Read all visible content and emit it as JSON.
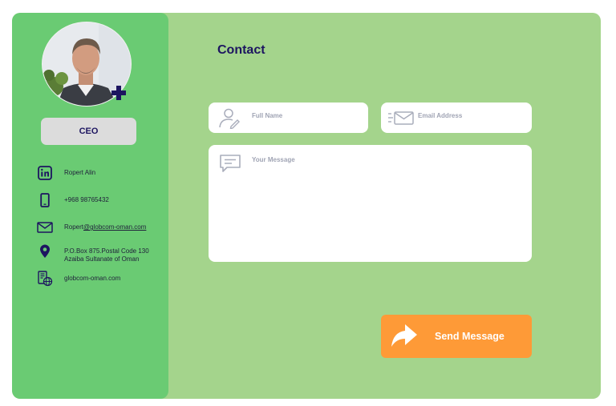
{
  "profile": {
    "role": "CEO"
  },
  "contact_info": {
    "name": "Ropert Alin",
    "phone": "+968 98765432",
    "email_prefix": "Ropert",
    "email_domain": "@globcom-oman.com",
    "address_line1": "P.O.Box 875.Postal Code 130",
    "address_line2": "Azaiba Sultanate of Oman",
    "website": "globcom-oman.com"
  },
  "form": {
    "title": "Contact",
    "full_name_placeholder": "Full Name",
    "email_placeholder": "Email Address",
    "message_placeholder": "Your Message",
    "send_label": "Send Message"
  },
  "colors": {
    "page_bg": "#a4d48c",
    "sidebar_bg": "#6acb73",
    "accent_dark": "#1d1560",
    "button": "#fe9a37"
  },
  "icons": [
    "plus-icon",
    "linkedin-icon",
    "phone-icon",
    "mail-icon",
    "location-pin-icon",
    "website-icon",
    "user-edit-icon",
    "envelope-fast-icon",
    "message-icon",
    "share-arrow-icon"
  ]
}
